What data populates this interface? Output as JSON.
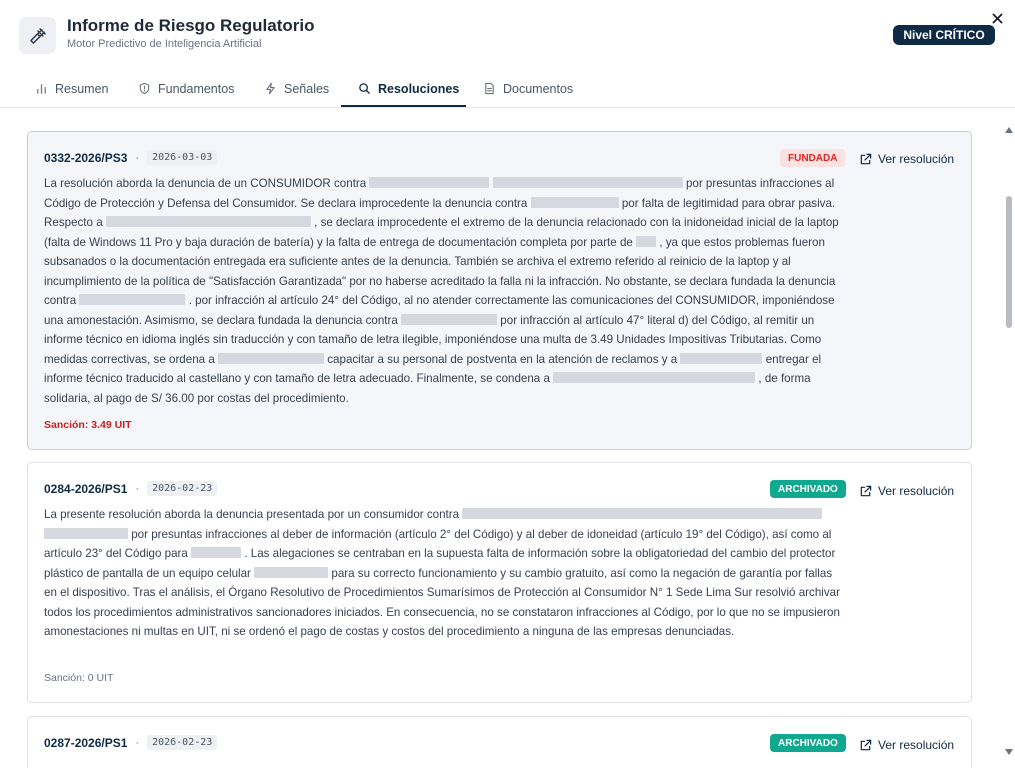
{
  "header": {
    "title": "Informe de Riesgo Regulatorio",
    "subtitle": "Motor Predictivo de Inteligencia Artificial",
    "level_badge": "Nivel CRÍTICO",
    "logo_icon": "gavel-icon",
    "close_icon": "close-icon"
  },
  "tabs": [
    {
      "label": "Resumen",
      "icon": "bar-chart-icon",
      "active": false
    },
    {
      "label": "Fundamentos",
      "icon": "shield-icon",
      "active": false
    },
    {
      "label": "Señales",
      "icon": "lightning-icon",
      "active": false
    },
    {
      "label": "Resoluciones",
      "icon": "search-icon",
      "active": true
    },
    {
      "label": "Documentos",
      "icon": "document-icon",
      "active": false
    }
  ],
  "colors": {
    "brand": "#0f2a44",
    "fundada_bg": "#fde2e2",
    "fundada_text": "#dc2626",
    "archivado_bg": "#10a88e",
    "sanction_red": "#c81e1e"
  },
  "resolutions": [
    {
      "id": "0332-2026/PS3",
      "date": "2026-03-03",
      "status": "FUNDADA",
      "link_label": "Ver resolución",
      "text": {
        "p1": "La resolución aborda la denuncia de un CONSUMIDOR contra",
        "p2": "por presuntas infracciones al Código de Protección y Defensa del Consumidor. Se declara improcedente la denuncia contra",
        "p3": "por falta de legitimidad para obrar pasiva. Respecto a",
        "p4": ", se declara improcedente el extremo de la denuncia relacionado con la inidoneidad inicial de la laptop (falta de Windows 11 Pro y baja duración de batería) y la falta de entrega de documentación completa por parte de",
        "p5": ", ya que estos problemas fueron subsanados o la documentación entregada era suficiente antes de la denuncia. También se archiva el extremo referido al reinicio de la laptop y al incumplimiento de la política de \"Satisfacción Garantizada\" por no haberse acreditado la falla ni la infracción. No obstante, se declara fundada la denuncia contra",
        "p6": ". por infracción al artículo 24° del Código, al no atender correctamente las comunicaciones del CONSUMIDOR, imponiéndose una amonestación. Asimismo, se declara fundada la denuncia contra",
        "p7": "por infracción al artículo 47° literal d) del Código, al remitir un informe técnico en idioma inglés sin traducción y con tamaño de letra ilegible, imponiéndose una multa de 3.49 Unidades Impositivas Tributarias. Como medidas correctivas, se ordena a",
        "p8": "capacitar a su personal de postventa en la atención de reclamos y a",
        "p9": "entregar el informe técnico traducido al castellano y con tamaño de letra adecuado. Finalmente, se condena a",
        "p10": ", de forma solidaria, al pago de S/ 36.00 por costas del procedimiento."
      },
      "sanction": "Sanción: 3.49 UIT"
    },
    {
      "id": "0284-2026/PS1",
      "date": "2026-02-23",
      "status": "ARCHIVADO",
      "link_label": "Ver resolución",
      "text": {
        "p1": "La presente resolución aborda la denuncia presentada por un consumidor contra",
        "p2": "por presuntas infracciones al deber de información (artículo 2° del Código) y al deber de idoneidad (artículo 19° del Código), así como al artículo 23° del Código para",
        "p3": ". Las alegaciones se centraban en la supuesta falta de información sobre la obligatoriedad del cambio del protector plástico de pantalla de un equipo celular",
        "p4": "para su correcto funcionamiento y su cambio gratuito, así como la negación de garantía por fallas en el dispositivo. Tras el análisis, el Órgano Resolutivo de Procedimientos Sumarísimos de Protección al Consumidor N° 1 Sede Lima Sur resolvió archivar todos los procedimientos administrativos sancionadores iniciados. En consecuencia, no se constataron infracciones al Código, por lo que no se impusieron amonestaciones ni multas en UIT, ni se ordenó el pago de costas y costos del procedimiento a ninguna de las empresas denunciadas."
      },
      "sanction": "Sanción: 0 UIT"
    },
    {
      "id": "0287-2026/PS1",
      "date": "2026-02-23",
      "status": "ARCHIVADO",
      "link_label": "Ver resolución"
    }
  ]
}
